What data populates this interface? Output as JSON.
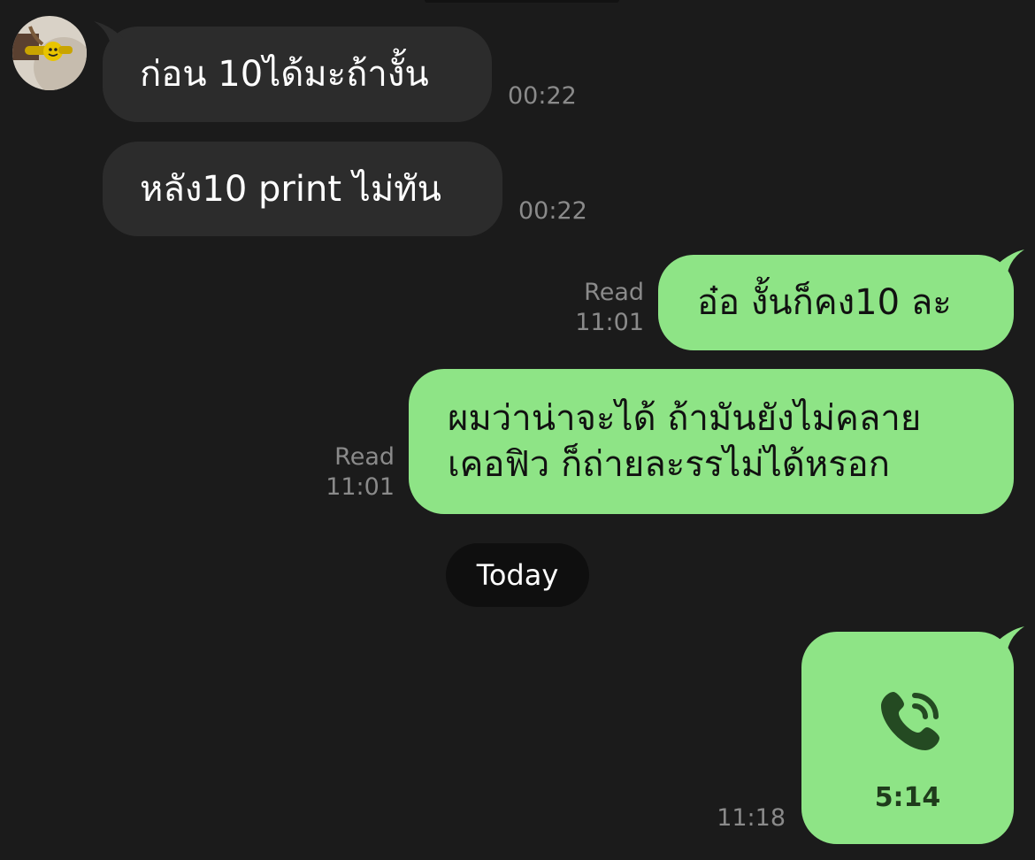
{
  "messages": [
    {
      "direction": "incoming",
      "text": "ก่อน 10ได้มะถ้างั้น",
      "time": "00:22"
    },
    {
      "direction": "incoming",
      "text": "หลัง10 print ไม่ทัน",
      "time": "00:22"
    },
    {
      "direction": "outgoing",
      "text": "อ๋อ งั้นก็คง10 ละ",
      "status": "Read",
      "time": "11:01"
    },
    {
      "direction": "outgoing",
      "lines": [
        "ผมว่าน่าจะได้ ถ้ามันยังไม่คลาย",
        "เคอฟิว ก็ถ่ายละรรไม่ได้หรอก"
      ],
      "status": "Read",
      "time": "11:01"
    }
  ],
  "date_separator": "Today",
  "call": {
    "icon": "phone-call-icon",
    "duration": "5:14",
    "time": "11:18"
  },
  "colors": {
    "background": "#1b1b1b",
    "incoming_bubble": "#2c2c2c",
    "outgoing_bubble": "#8ee486",
    "meta_text": "#8a8a8a"
  }
}
